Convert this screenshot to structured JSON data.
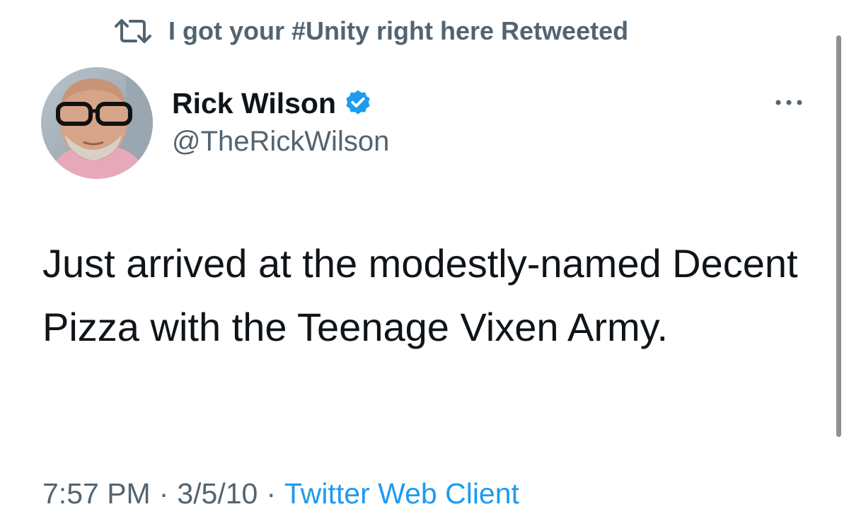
{
  "social_context": {
    "icon": "retweet-icon",
    "text": "I got your #Unity right here Retweeted"
  },
  "author": {
    "display_name": "Rick Wilson",
    "verified": true,
    "verified_icon": "verified-badge-icon",
    "handle": "@TheRickWilson"
  },
  "more_icon": "more-options-icon",
  "tweet": {
    "text": "Just arrived at the modestly-named Decent Pizza with the Teenage Vixen Army."
  },
  "meta": {
    "time": "7:57 PM",
    "separator": "·",
    "date": "3/5/10",
    "source": "Twitter Web Client"
  },
  "colors": {
    "primary_text": "#0f1419",
    "secondary_text": "#536471",
    "accent": "#1d9bf0"
  }
}
